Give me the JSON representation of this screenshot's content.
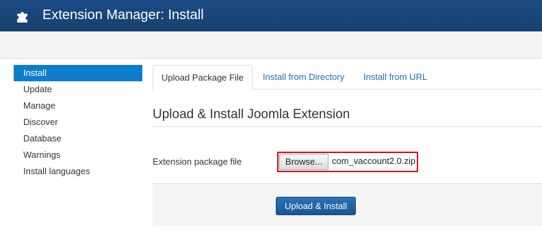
{
  "header": {
    "title": "Extension Manager: Install",
    "icon": "puzzle-icon"
  },
  "sidebar": {
    "items": [
      {
        "label": "Install",
        "active": true
      },
      {
        "label": "Update"
      },
      {
        "label": "Manage"
      },
      {
        "label": "Discover"
      },
      {
        "label": "Database"
      },
      {
        "label": "Warnings"
      },
      {
        "label": "Install languages"
      }
    ]
  },
  "tabs": [
    {
      "label": "Upload Package File",
      "active": true
    },
    {
      "label": "Install from Directory"
    },
    {
      "label": "Install from URL"
    }
  ],
  "main": {
    "section_title": "Upload & Install Joomla Extension",
    "field_label": "Extension package file",
    "browse_label": "Browse...",
    "file_name": "com_vaccount2.0.zip",
    "install_button": "Upload & Install"
  },
  "colors": {
    "header_bg": "#17406f",
    "active_sidebar": "#0e7ccd",
    "link": "#1b6fb3",
    "highlight_border": "#d9091c",
    "primary_button": "#1a5594"
  }
}
